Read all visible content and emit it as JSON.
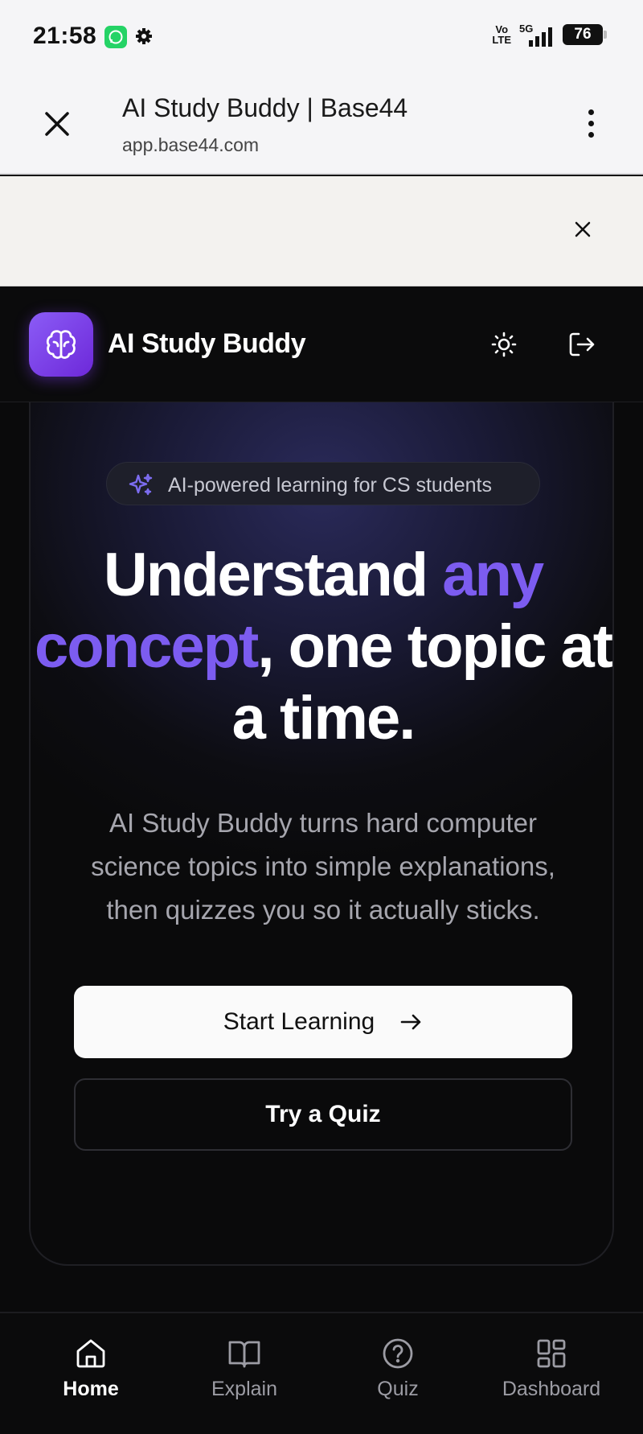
{
  "status_bar": {
    "time": "21:58",
    "network_volte": "Vo\nLTE",
    "network_type": "5G",
    "battery": "76"
  },
  "browser": {
    "page_title": "AI Study Buddy | Base44",
    "url": "app.base44.com"
  },
  "app": {
    "name": "AI Study Buddy",
    "theme_icon": "sun-icon",
    "logout_icon": "logout-icon"
  },
  "hero": {
    "badge": "AI-powered learning for CS students",
    "headline": {
      "part1": "Understand ",
      "accent": "any concept",
      "part2": ", one topic at a time."
    },
    "description": "AI Study Buddy turns hard computer science topics into simple explanations, then quizzes you so it actually sticks.",
    "primary_button": "Start Learning",
    "secondary_button": "Try a Quiz"
  },
  "nav": {
    "items": [
      {
        "label": "Home",
        "icon": "home-icon",
        "active": true
      },
      {
        "label": "Explain",
        "icon": "book-icon",
        "active": false
      },
      {
        "label": "Quiz",
        "icon": "help-circle-icon",
        "active": false
      },
      {
        "label": "Dashboard",
        "icon": "grid-icon",
        "active": false
      }
    ]
  },
  "colors": {
    "accent": "#7c5cf0",
    "logo_gradient_start": "#8b5cf6",
    "logo_gradient_end": "#6d28d9",
    "background": "#0a0a0b"
  }
}
